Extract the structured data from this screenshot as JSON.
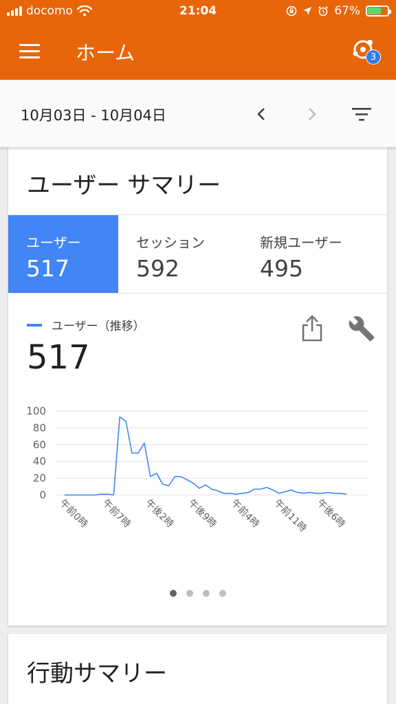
{
  "status": {
    "carrier": "docomo",
    "time": "21:04",
    "battery": "67%",
    "battery_level": 0.67
  },
  "appbar": {
    "title": "ホーム",
    "account_badge": "3"
  },
  "datebar": {
    "range": "10月03日 - 10月04日"
  },
  "summary": {
    "title": "ユーザー サマリー",
    "metrics": [
      {
        "label": "ユーザー",
        "value": "517"
      },
      {
        "label": "セッション",
        "value": "592"
      },
      {
        "label": "新規ユーザー",
        "value": "495"
      }
    ],
    "legend": "ユーザー（推移）",
    "big_value": "517"
  },
  "chart_data": {
    "type": "line",
    "series": [
      {
        "name": "ユーザー（推移）",
        "color": "#4285f4",
        "values": [
          0,
          0,
          0,
          0,
          0,
          0,
          1,
          1,
          0,
          93,
          88,
          50,
          50,
          62,
          22,
          26,
          13,
          11,
          22,
          22,
          18,
          14,
          8,
          12,
          7,
          5,
          2,
          2,
          1,
          2,
          3,
          7,
          7,
          9,
          6,
          2,
          4,
          6,
          3,
          2,
          3,
          2,
          2,
          3,
          2,
          2,
          1
        ]
      }
    ],
    "y_ticks": [
      "100",
      "80",
      "60",
      "40",
      "20",
      "0"
    ],
    "ylim": [
      0,
      100
    ],
    "x_tick_labels": [
      "午前0時",
      "午前7時",
      "午後2時",
      "午後9時",
      "午前4時",
      "午前11時",
      "午後6時"
    ],
    "x_tick_index": [
      0,
      7,
      14,
      21,
      28,
      35,
      42
    ],
    "grid": true
  },
  "pager": {
    "count": 4,
    "active": 0
  },
  "behavior": {
    "title": "行動サマリー"
  }
}
